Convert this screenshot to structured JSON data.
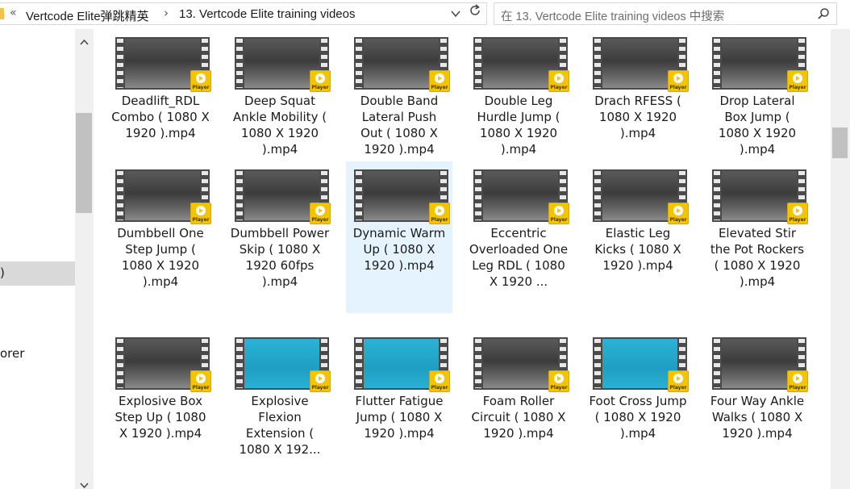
{
  "address_bar": {
    "overflow_chevron": "«",
    "crumbs": [
      "Vertcode Elite弹跳精英",
      "13. Vertcode Elite training videos"
    ],
    "separator": "›"
  },
  "search": {
    "placeholder": "在 13. Vertcode Elite training videos 中搜索"
  },
  "nav_pane": {
    "selected_item_text": ")",
    "item_text": "orer"
  },
  "files": [
    {
      "name": "Deadlift_RDL Combo ( 1080 X 1920 ).mp4",
      "badge": "Player"
    },
    {
      "name": "Deep Squat Ankle Mobility ( 1080 X 1920 ).mp4",
      "badge": "Player"
    },
    {
      "name": "Double Band Lateral Push Out ( 1080 X 1920 ).mp4",
      "badge": "Player"
    },
    {
      "name": "Double Leg Hurdle Jump ( 1080 X 1920 ).mp4",
      "badge": "Player"
    },
    {
      "name": "Drach RFESS ( 1080 X 1920 ).mp4",
      "badge": "Player"
    },
    {
      "name": "Drop Lateral Box Jump ( 1080 X 1920 ).mp4",
      "badge": "Player"
    },
    {
      "name": "Dumbbell One Step Jump ( 1080 X 1920 ).mp4",
      "badge": "Player"
    },
    {
      "name": "Dumbbell Power Skip ( 1080 X 1920 60fps ).mp4",
      "badge": "Player"
    },
    {
      "name": "Dynamic Warm Up ( 1080 X 1920 ).mp4",
      "badge": "Player",
      "selected": true
    },
    {
      "name": "Eccentric Overloaded One Leg RDL ( 1080 X 1920 ...",
      "badge": "Player"
    },
    {
      "name": "Elastic Leg Kicks ( 1080 X 1920 ).mp4",
      "badge": "Player"
    },
    {
      "name": "Elevated Stir the Pot Rockers ( 1080 X 1920 ).mp4",
      "badge": "Player"
    },
    {
      "name": "Explosive Box Step Up ( 1080 X 1920 ).mp4",
      "badge": "Player"
    },
    {
      "name": "Explosive Flexion Extension ( 1080 X 192...",
      "badge": "Player"
    },
    {
      "name": "Flutter Fatigue Jump ( 1080 X 1920 ).mp4",
      "badge": "Player"
    },
    {
      "name": "Foam Roller Circuit ( 1080 X 1920 ).mp4",
      "badge": "Player"
    },
    {
      "name": "Foot Cross Jump ( 1080 X 1920 ).mp4",
      "badge": "Player"
    },
    {
      "name": "Four Way Ankle Walks ( 1080 X 1920 ).mp4",
      "badge": "Player"
    }
  ],
  "colors": {
    "selection": "#e5f3ff",
    "badge": "#f5c400",
    "pool": "#2bb3d6",
    "gym": "#3c3c3c"
  }
}
